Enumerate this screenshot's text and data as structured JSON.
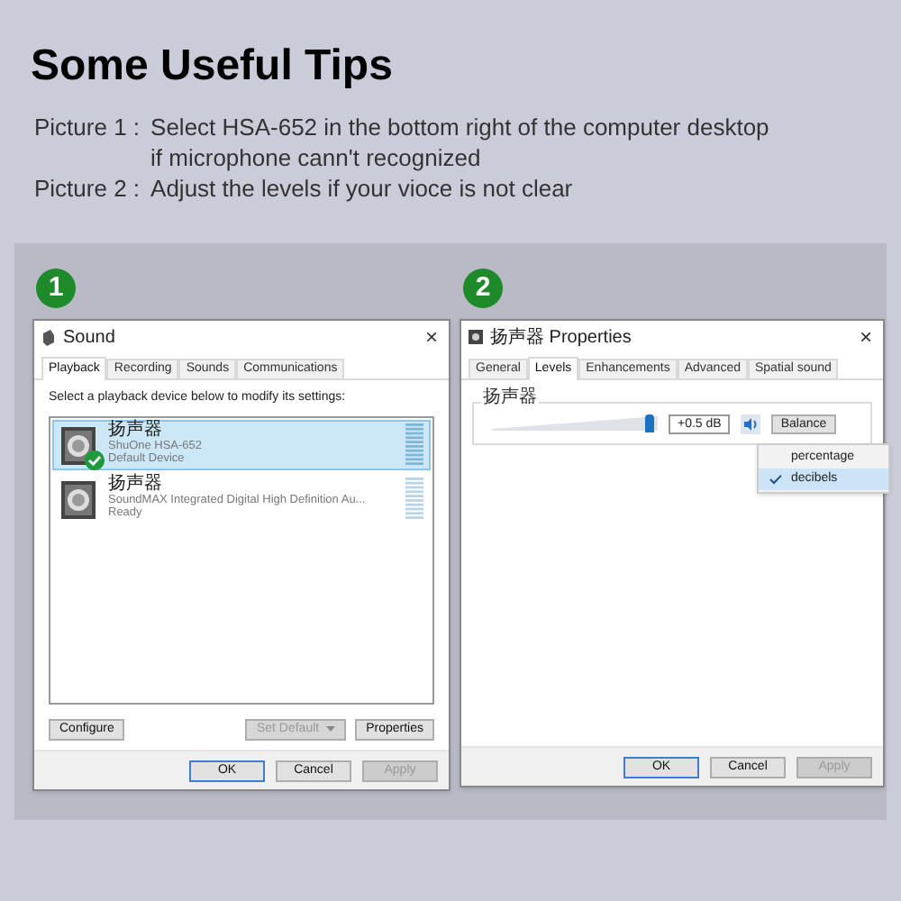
{
  "heading": "Some Useful Tips",
  "tips": [
    {
      "label": "Picture 1 :",
      "lines": [
        "Select HSA-652 in the bottom right of the computer desktop",
        "if microphone cann't recognized"
      ]
    },
    {
      "label": "Picture 2 :",
      "lines": [
        "Adjust the levels if your vioce is not clear"
      ]
    }
  ],
  "sound_dialog": {
    "badge": "1",
    "title": "Sound",
    "close": "×",
    "tabs": [
      {
        "label": "Playback",
        "selected": true
      },
      {
        "label": "Recording",
        "selected": false
      },
      {
        "label": "Sounds",
        "selected": false
      },
      {
        "label": "Communications",
        "selected": false
      }
    ],
    "instruction": "Select a playback device below to modify its settings:",
    "devices": [
      {
        "name": "扬声器",
        "description": "ShuOne HSA-652",
        "status": "Default Device",
        "selected": true,
        "default": true
      },
      {
        "name": "扬声器",
        "description": "SoundMAX Integrated Digital High Definition Au...",
        "status": "Ready",
        "selected": false,
        "default": false
      }
    ],
    "buttons": [
      {
        "label": "Configure",
        "disabled": false
      },
      {
        "label": "Set Default",
        "disabled": true,
        "dropdown": true
      },
      {
        "label": "Properties",
        "disabled": false
      }
    ],
    "footer": [
      {
        "label": "OK",
        "disabled": false,
        "focused": true
      },
      {
        "label": "Cancel",
        "disabled": false,
        "focused": false
      },
      {
        "label": "Apply",
        "disabled": true,
        "focused": false
      }
    ]
  },
  "properties_dialog": {
    "badge": "2",
    "title": "扬声器 Properties",
    "close": "×",
    "tabs": [
      {
        "label": "General",
        "selected": false
      },
      {
        "label": "Levels",
        "selected": true
      },
      {
        "label": "Enhancements",
        "selected": false
      },
      {
        "label": "Advanced",
        "selected": false
      },
      {
        "label": "Spatial sound",
        "selected": false
      }
    ],
    "group_label": "扬声器",
    "level": 0.95,
    "reading": "+0.5 dB",
    "balance": "Balance",
    "menu": [
      {
        "label": "percentage",
        "checked": false
      },
      {
        "label": "decibels",
        "checked": true
      }
    ],
    "footer": [
      {
        "label": "OK",
        "disabled": false,
        "focused": true
      },
      {
        "label": "Cancel",
        "disabled": false,
        "focused": false
      },
      {
        "label": "Apply",
        "disabled": true,
        "focused": false
      }
    ]
  }
}
